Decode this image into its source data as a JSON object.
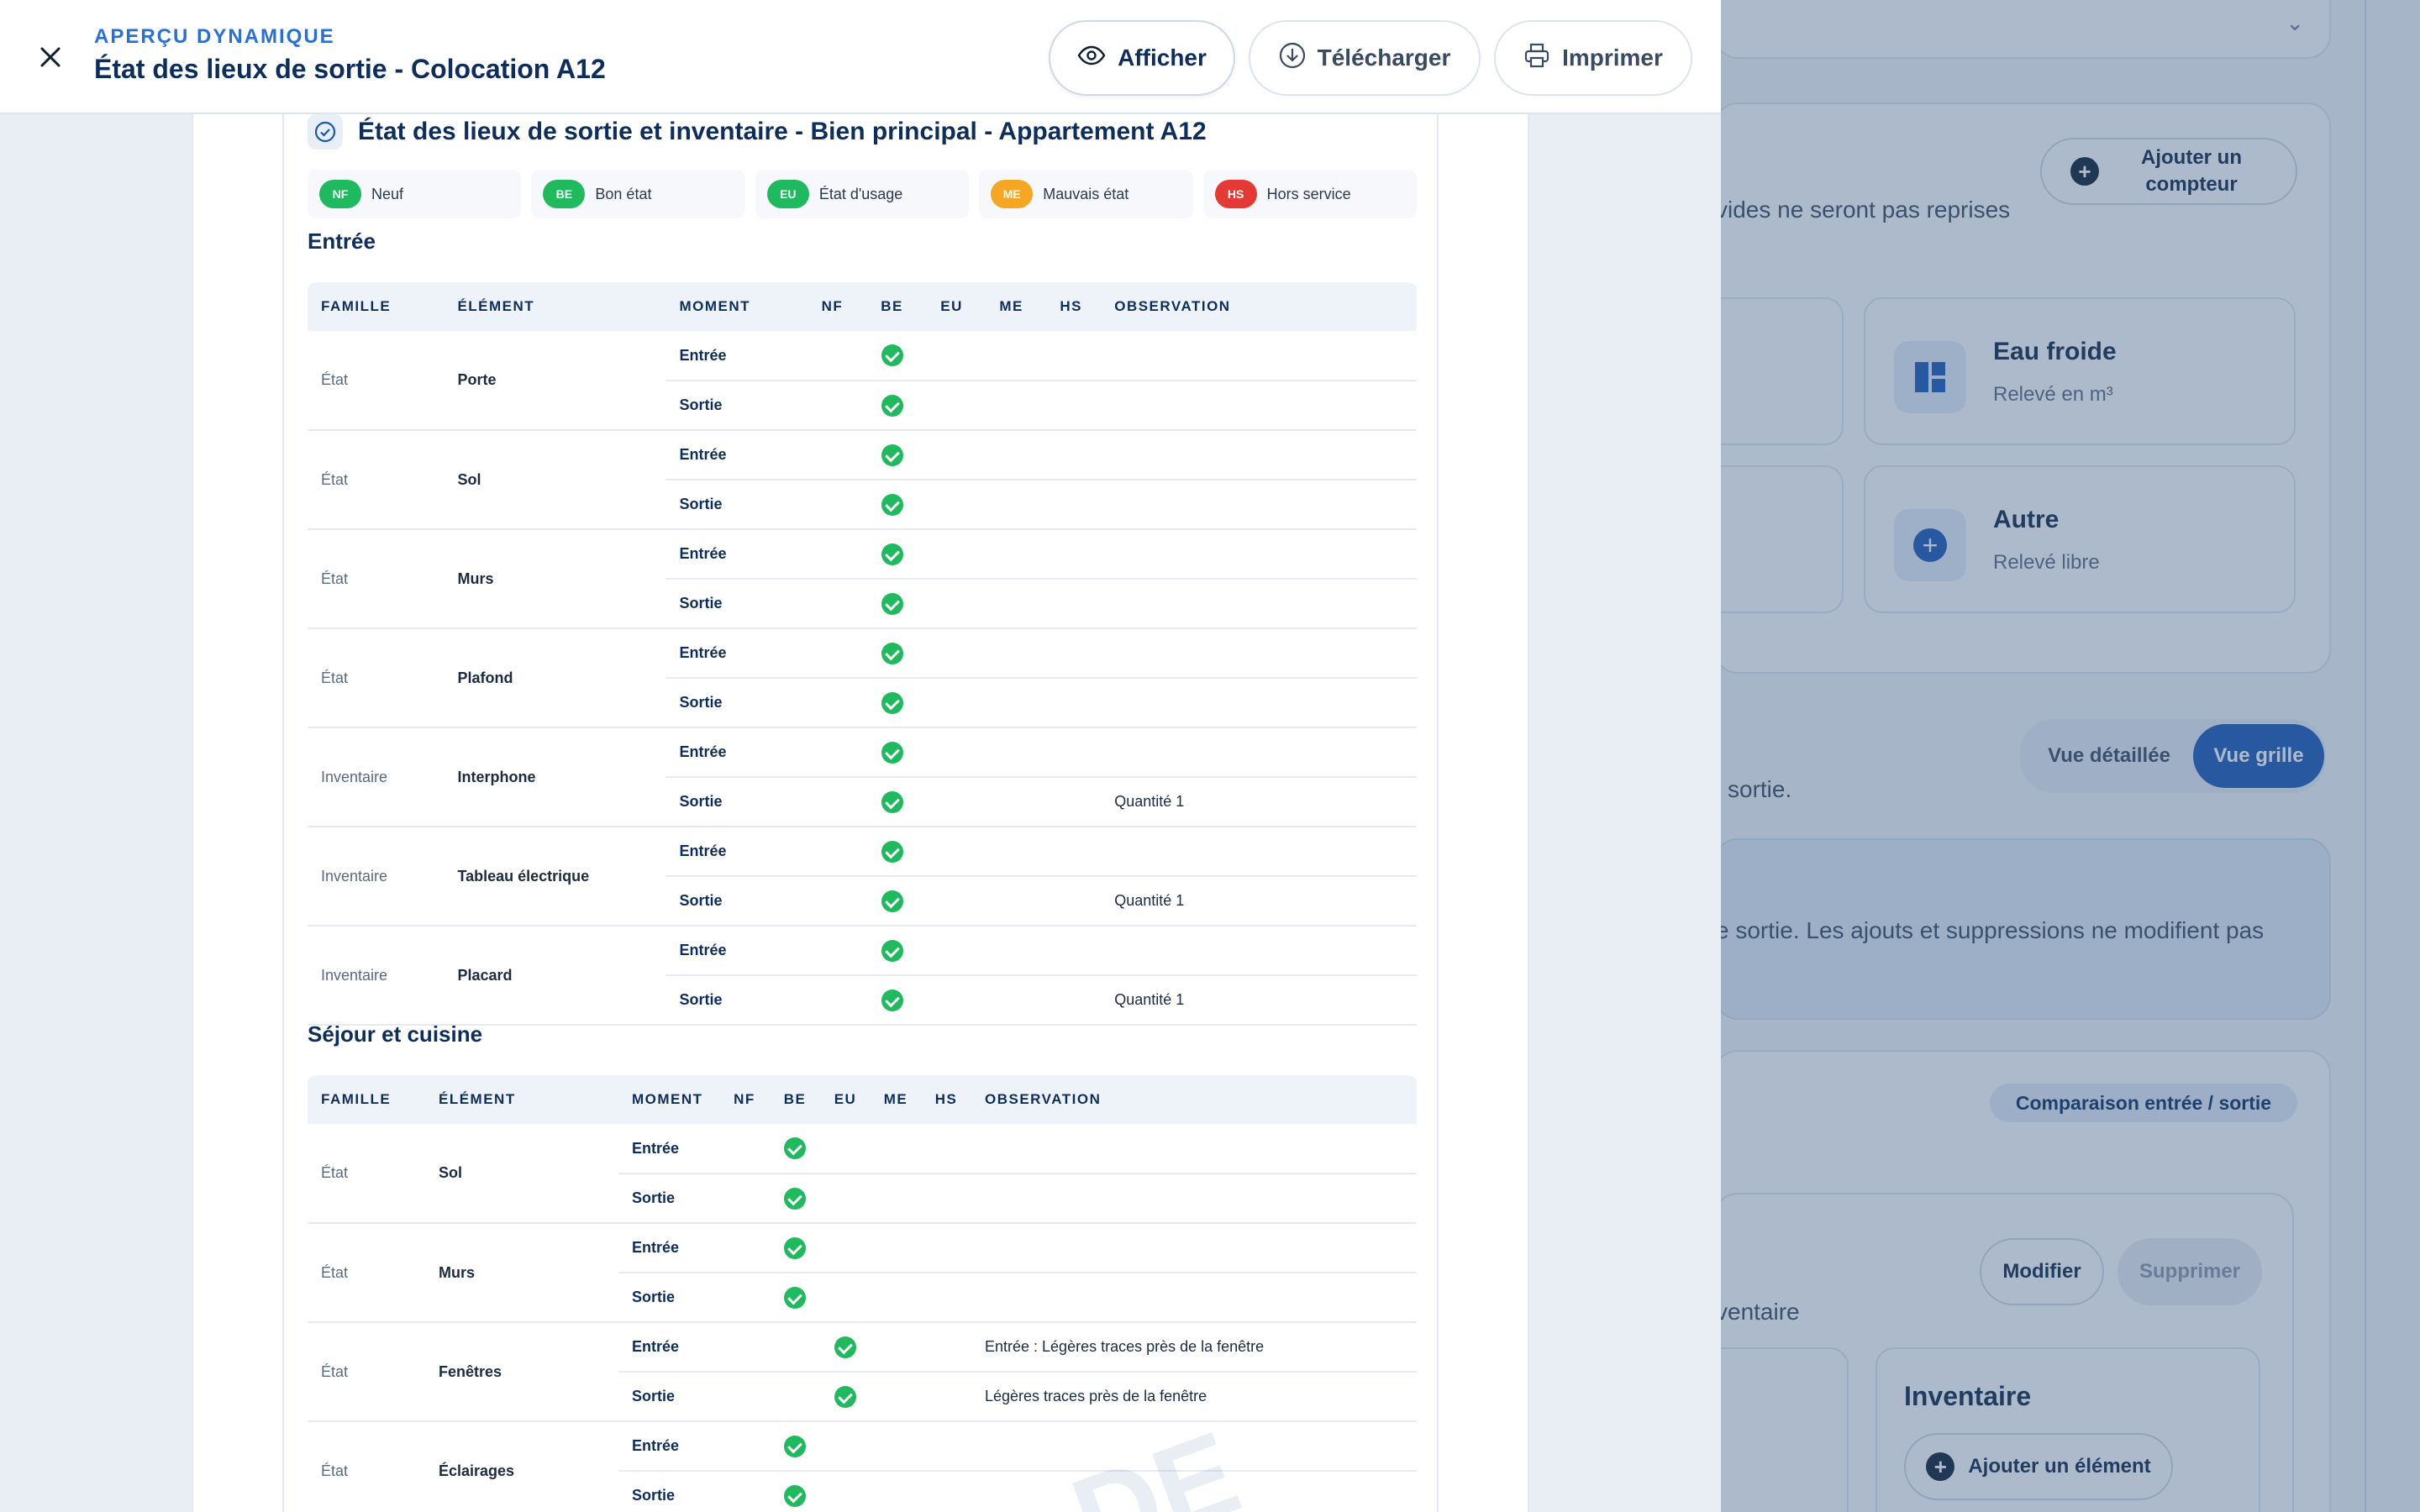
{
  "header": {
    "eyebrow": "APERÇU DYNAMIQUE",
    "title": "État des lieux de sortie - Colocation A12",
    "buttons": {
      "afficher": "Afficher",
      "telecharger": "Télécharger",
      "imprimer": "Imprimer"
    }
  },
  "document": {
    "section_title": "État des lieux de sortie et inventaire - Bien principal - Appartement A12",
    "legend": [
      {
        "code": "NF",
        "label": "Neuf",
        "color": "#1fba5d"
      },
      {
        "code": "BE",
        "label": "Bon état",
        "color": "#1fba5d"
      },
      {
        "code": "EU",
        "label": "État d'usage",
        "color": "#1fba5d"
      },
      {
        "code": "ME",
        "label": "Mauvais état",
        "color": "#f5a623"
      },
      {
        "code": "HS",
        "label": "Hors service",
        "color": "#e53935"
      }
    ],
    "columns": [
      "FAMILLE",
      "ÉLÉMENT",
      "MOMENT",
      "NF",
      "BE",
      "EU",
      "ME",
      "HS",
      "OBSERVATION"
    ],
    "rooms": [
      {
        "name": "Entrée",
        "rows": [
          {
            "famille": "État",
            "element": "Porte",
            "entries": [
              {
                "moment": "Entrée",
                "state": "BE",
                "obs": ""
              },
              {
                "moment": "Sortie",
                "state": "BE",
                "obs": ""
              }
            ]
          },
          {
            "famille": "État",
            "element": "Sol",
            "entries": [
              {
                "moment": "Entrée",
                "state": "BE",
                "obs": ""
              },
              {
                "moment": "Sortie",
                "state": "BE",
                "obs": ""
              }
            ]
          },
          {
            "famille": "État",
            "element": "Murs",
            "entries": [
              {
                "moment": "Entrée",
                "state": "BE",
                "obs": ""
              },
              {
                "moment": "Sortie",
                "state": "BE",
                "obs": ""
              }
            ]
          },
          {
            "famille": "État",
            "element": "Plafond",
            "entries": [
              {
                "moment": "Entrée",
                "state": "BE",
                "obs": ""
              },
              {
                "moment": "Sortie",
                "state": "BE",
                "obs": ""
              }
            ]
          },
          {
            "famille": "Inventaire",
            "element": "Interphone",
            "entries": [
              {
                "moment": "Entrée",
                "state": "BE",
                "obs": ""
              },
              {
                "moment": "Sortie",
                "state": "BE",
                "obs": "Quantité 1"
              }
            ]
          },
          {
            "famille": "Inventaire",
            "element": "Tableau électrique",
            "entries": [
              {
                "moment": "Entrée",
                "state": "BE",
                "obs": ""
              },
              {
                "moment": "Sortie",
                "state": "BE",
                "obs": "Quantité 1"
              }
            ]
          },
          {
            "famille": "Inventaire",
            "element": "Placard",
            "entries": [
              {
                "moment": "Entrée",
                "state": "BE",
                "obs": ""
              },
              {
                "moment": "Sortie",
                "state": "BE",
                "obs": "Quantité 1"
              }
            ]
          }
        ]
      },
      {
        "name": "Séjour et cuisine",
        "rows": [
          {
            "famille": "État",
            "element": "Sol",
            "entries": [
              {
                "moment": "Entrée",
                "state": "BE",
                "obs": ""
              },
              {
                "moment": "Sortie",
                "state": "BE",
                "obs": ""
              }
            ]
          },
          {
            "famille": "État",
            "element": "Murs",
            "entries": [
              {
                "moment": "Entrée",
                "state": "BE",
                "obs": ""
              },
              {
                "moment": "Sortie",
                "state": "BE",
                "obs": ""
              }
            ]
          },
          {
            "famille": "État",
            "element": "Fenêtres",
            "entries": [
              {
                "moment": "Entrée",
                "state": "EU",
                "obs": "Entrée : Légères traces près de la fenêtre"
              },
              {
                "moment": "Sortie",
                "state": "EU",
                "obs": "Légères traces près de la fenêtre"
              }
            ]
          },
          {
            "famille": "État",
            "element": "Éclairages",
            "entries": [
              {
                "moment": "Entrée",
                "state": "BE",
                "obs": ""
              },
              {
                "moment": "Sortie",
                "state": "BE",
                "obs": ""
              }
            ]
          }
        ]
      }
    ]
  },
  "background": {
    "add_meter": "Ajouter un compteur",
    "empty_note": "vides ne seront pas reprises",
    "tiles": [
      {
        "title": "Eau froide",
        "sub": "Relevé en m³",
        "icon": "grid-icon"
      },
      {
        "title": "Autre",
        "sub": "Relevé libre",
        "icon": "plus-icon"
      }
    ],
    "view_detail": "Vue détaillée",
    "view_grid": "Vue grille",
    "sortie_text": "sortie.",
    "info_text": "e sortie. Les ajouts et suppressions ne modifient pas",
    "compare_badge": "Comparaison entrée / sortie",
    "modifier": "Modifier",
    "supprimer": "Supprimer",
    "inventaire_text": "ventaire",
    "inventaire_title": "Inventaire",
    "add_element": "Ajouter un élément"
  }
}
